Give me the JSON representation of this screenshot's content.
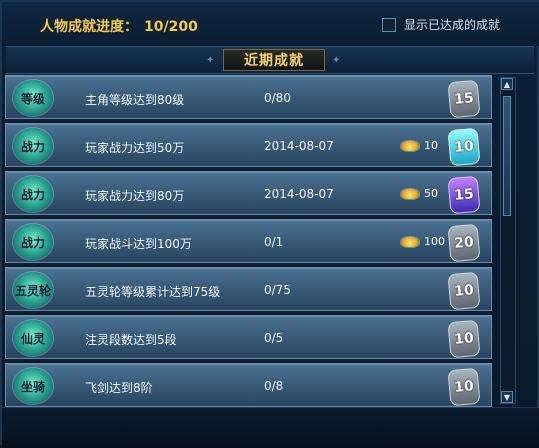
{
  "header": {
    "progress_label": "人物成就进度：",
    "progress_value": "10/200",
    "show_done_label": "显示已达成的成就"
  },
  "section": {
    "title": "近期成就"
  },
  "achievements": [
    {
      "badge_label": "等级",
      "name": "主角等级达到80级",
      "status": "0/80",
      "reward": "",
      "points": "15",
      "points_style": "stone"
    },
    {
      "badge_label": "战力",
      "name": "玩家战力达到50万",
      "status": "2014-08-07",
      "reward": "10",
      "points": "10",
      "points_style": "cyan"
    },
    {
      "badge_label": "战力",
      "name": "玩家战力达到80万",
      "status": "2014-08-07",
      "reward": "50",
      "points": "15",
      "points_style": "purple"
    },
    {
      "badge_label": "战力",
      "name": "玩家战斗达到100万",
      "status": "0/1",
      "reward": "100",
      "points": "20",
      "points_style": "stone"
    },
    {
      "badge_label": "五灵轮",
      "name": "五灵轮等级累计达到75级",
      "status": "0/75",
      "reward": "",
      "points": "10",
      "points_style": "stone"
    },
    {
      "badge_label": "仙灵",
      "name": "注灵段数达到5段",
      "status": "0/5",
      "reward": "",
      "points": "10",
      "points_style": "stone"
    },
    {
      "badge_label": "坐骑",
      "name": "飞剑达到8阶",
      "status": "0/8",
      "reward": "",
      "points": "10",
      "points_style": "stone"
    }
  ],
  "icons": {
    "reward_icon": "gold-ingot-icon",
    "scroll_up": "chevron-up-icon",
    "scroll_down": "chevron-down-icon"
  }
}
